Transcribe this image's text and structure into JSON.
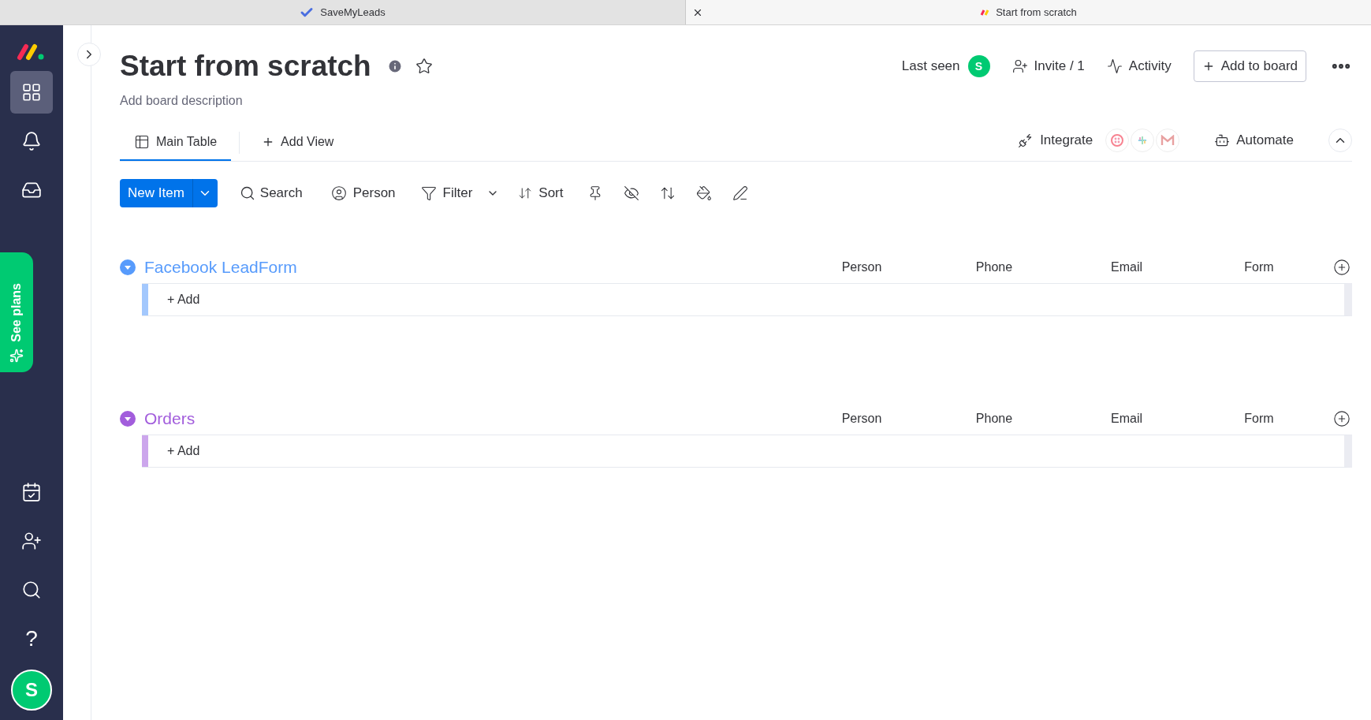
{
  "browser_tabs": [
    {
      "title": "SaveMyLeads",
      "selected": false,
      "closable": false
    },
    {
      "title": "Start from scratch",
      "selected": true,
      "closable": true
    }
  ],
  "sidebar": {
    "upgrade": "See plans",
    "help": "?",
    "avatar": "S"
  },
  "board": {
    "title": "Start from scratch",
    "description": "Add board description",
    "last_seen": "Last seen",
    "last_seen_avatar": "S",
    "invite": "Invite / 1",
    "activity": "Activity",
    "add_to_board": "Add to board"
  },
  "views": [
    {
      "label": "Main Table",
      "selected": true
    },
    {
      "label": "Add View",
      "selected": false
    }
  ],
  "integrate": "Integrate",
  "automate": "Automate",
  "toolbar": {
    "new_item": "New Item",
    "search": "Search",
    "person": "Person",
    "filter": "Filter",
    "sort": "Sort"
  },
  "groups": [
    {
      "name": "Facebook LeadForm",
      "color": "#579bfc",
      "columns": [
        "Person",
        "Phone",
        "Email",
        "Form"
      ],
      "add": "+ Add"
    },
    {
      "name": "Orders",
      "color": "#a25ddc",
      "columns": [
        "Person",
        "Phone",
        "Email",
        "Form"
      ],
      "add": "+ Add"
    }
  ]
}
